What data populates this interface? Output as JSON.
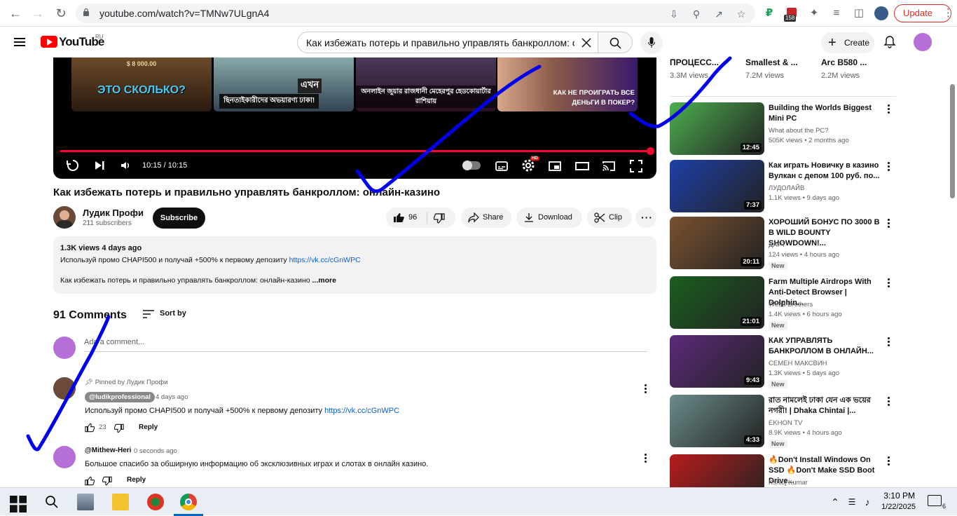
{
  "browser": {
    "url": "youtube.com/watch?v=TMNw7ULgnA4",
    "update_label": "Update",
    "ext_badge": "158"
  },
  "yt": {
    "wordmark": "YouTube",
    "country": "RU",
    "search_value": "Как избежать потерь и правильно управлять банкроллом: онлай",
    "create_label": "Create"
  },
  "player": {
    "endcards": [
      {
        "text": "ЭТО СКОЛЬКО?",
        "sub": "$ 8 000.00"
      },
      {
        "text": "ছিনতাইকারীদের অভয়ারণ্য ঢাকা!",
        "sub": "এখন"
      },
      {
        "text": "অনলাইন জুয়ার রাজধানী মেহেরপুর হেডকোয়ার্টার রাশিয়ায়",
        "sub": ""
      },
      {
        "text": "КАК НЕ ПРОИГРАТЬ ВСЕ ДЕНЬГИ В ПОКЕР?",
        "sub": ""
      }
    ],
    "time": "10:15 / 10:15",
    "progress": 1.0,
    "settings_badge": "HD"
  },
  "video": {
    "title": "Как избежать потерь и правильно управлять банкроллом: онлайн-казино",
    "channel": "Лудик Профи",
    "subscribers": "211 subscribers",
    "subscribe_label": "Subscribe",
    "likes": "96",
    "share_label": "Share",
    "download_label": "Download",
    "clip_label": "Clip"
  },
  "description": {
    "meta": "1.3K views  4 days ago",
    "line1": "Используй промо CHAPI500 и получай +500% к первому депозиту ",
    "link": "https://vk.cc/cGnWPC",
    "line2": "Как избежать потерь и правильно управлять банкроллом: онлайн-казино ",
    "more": "...more"
  },
  "comments": {
    "count": "91 Comments",
    "sort_label": "Sort by",
    "add_placeholder": "Add a comment...",
    "items": [
      {
        "pinned": "Pinned by Лудик Профи",
        "author": "@ludikprofessional",
        "time": "4 days ago",
        "text": "Используй промо CHAPI500 и получай +500% к первому депозиту ",
        "link": "https://vk.cc/cGnWPC",
        "likes": "23",
        "reply": "Reply"
      },
      {
        "author": "@Mithew-Heri",
        "time": "0 seconds ago",
        "text": "Большое спасибо за обширную информацию об эксклюзивных играх и слотах в онлайн казино.",
        "reply": "Reply"
      }
    ]
  },
  "sidebar": {
    "top_row": [
      {
        "title": "ПРОЦЕСС...",
        "views": "3.3M views"
      },
      {
        "title": "Smallest & ...",
        "views": "7.2M views"
      },
      {
        "title": "Arc B580 ...",
        "views": "2.2M views"
      }
    ],
    "videos": [
      {
        "title": "Building the Worlds Biggest Mini PC",
        "channel": "What about the PC?",
        "meta": "505K views • 2 months ago",
        "duration": "12:45",
        "new": "",
        "color": "#4caf50"
      },
      {
        "title": "Как играть Новичку в казино Вулкан с депом 100 руб. по...",
        "channel": "ЛУДОЛАЙВ",
        "meta": "1.1K views • 9 days ago",
        "duration": "7:37",
        "new": "",
        "color": "#1e3fa8"
      },
      {
        "title": "ХОРОШИЙ БОНУС ПО 3000 В В WILD BOUNTY SHOWDOWN!...",
        "channel": "ДАРТ",
        "meta": "124 views • 4 hours ago",
        "duration": "20:11",
        "new": "New",
        "color": "#7a5230"
      },
      {
        "title": "Farm Multiple Airdrops With Anti-Detect Browser | Dolphin...",
        "channel": "Web3 Brothers",
        "meta": "1.4K views • 6 hours ago",
        "duration": "21:01",
        "new": "New",
        "color": "#1b5e20"
      },
      {
        "title": "КАК УПРАВЛЯТЬ БАНКРОЛЛОМ В ОНЛАЙН...",
        "channel": "СЕМЕН МАКСВИН",
        "meta": "1.3K views • 5 days ago",
        "duration": "9:43",
        "new": "New",
        "color": "#5c2a7a"
      },
      {
        "title": "রাত নামলেই ঢাকা যেন এক ভয়ের নগরী! | Dhaka Chintai |...",
        "channel": "EKHON TV",
        "meta": "8.9K views • 4 hours ago",
        "duration": "4:33",
        "new": "New",
        "color": "#6a8c8a"
      },
      {
        "title": "🔥Don't Install Windows On SSD 🔥Don't Make SSD Boot Drive...",
        "channel": "Kshitij Kumar",
        "meta": "",
        "duration": "",
        "new": "",
        "color": "#b71c1c"
      }
    ]
  },
  "taskbar": {
    "time": "3:10 PM",
    "date": "1/22/2025",
    "notif_count": "6"
  },
  "colors": {
    "accent_red": "#ff0000",
    "link_blue": "#065fd4",
    "annotation_blue": "#0000ee"
  }
}
